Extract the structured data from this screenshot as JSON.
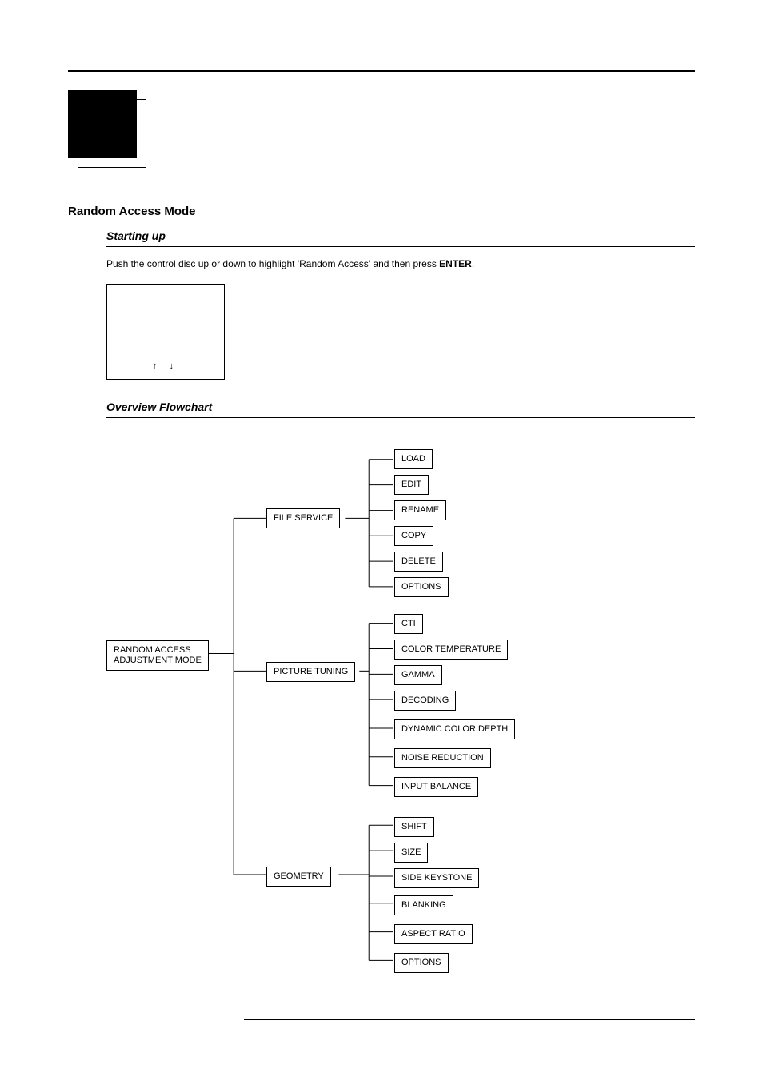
{
  "section_title": "Random Access Mode",
  "subsection1": "Starting up",
  "body_text_pre": "Push the control disc up or down to highlight 'Random Access' and then press ",
  "body_text_bold": "ENTER",
  "body_text_post": ".",
  "menu_arrows": "↑  ↓",
  "subsection2": "Overview Flowchart",
  "chart_data": {
    "type": "tree",
    "root": "RANDOM ACCESS ADJUSTMENT MODE",
    "children": [
      {
        "label": "FILE SERVICE",
        "children": [
          "LOAD",
          "EDIT",
          "RENAME",
          "COPY",
          "DELETE",
          "OPTIONS"
        ]
      },
      {
        "label": "PICTURE TUNING",
        "children": [
          "CTI",
          "COLOR TEMPERATURE",
          "GAMMA",
          "DECODING",
          "DYNAMIC COLOR DEPTH",
          "NOISE REDUCTION",
          "INPUT BALANCE"
        ]
      },
      {
        "label": "GEOMETRY",
        "children": [
          "SHIFT",
          "SIZE",
          "SIDE KEYSTONE",
          "BLANKING",
          "ASPECT RATIO",
          "OPTIONS"
        ]
      }
    ]
  },
  "nodes": {
    "root": "RANDOM ACCESS\nADJUSTMENT MODE",
    "file_service": "FILE SERVICE",
    "picture_tuning": "PICTURE TUNING",
    "geometry": "GEOMETRY",
    "load": "LOAD",
    "edit": "EDIT",
    "rename": "RENAME",
    "copy": "COPY",
    "delete": "DELETE",
    "options1": "OPTIONS",
    "cti": "CTI",
    "color_temp": "COLOR TEMPERATURE",
    "gamma": "GAMMA",
    "decoding": "DECODING",
    "dyn_color": "DYNAMIC COLOR DEPTH",
    "noise_red": "NOISE REDUCTION",
    "input_bal": "INPUT BALANCE",
    "shift": "SHIFT",
    "size": "SIZE",
    "side_key": "SIDE KEYSTONE",
    "blanking": "BLANKING",
    "aspect": "ASPECT RATIO",
    "options2": "OPTIONS"
  }
}
